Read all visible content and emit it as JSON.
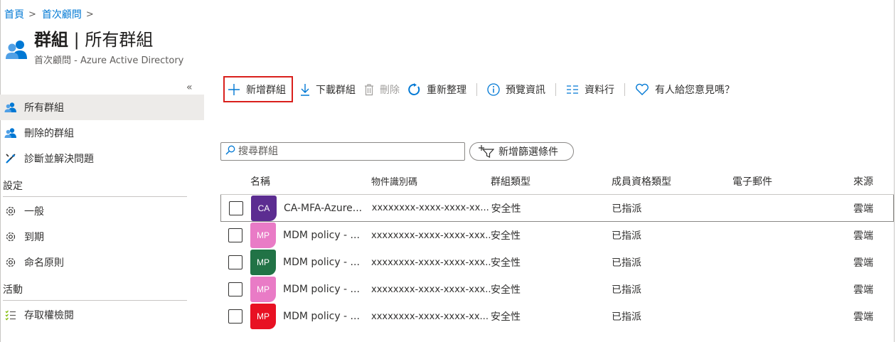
{
  "breadcrumb": {
    "items": [
      "首頁",
      "首次顧問"
    ]
  },
  "header": {
    "title_main": "群組",
    "title_sep": " | ",
    "title_sub": "所有群組",
    "subtitle": "首次顧問 - Azure Active Directory",
    "icon": "groups-icon"
  },
  "sidebar": {
    "collapse_label": "«",
    "items": [
      {
        "label": "所有群組",
        "icon": "groups-icon",
        "active": true
      },
      {
        "label": "刪除的群組",
        "icon": "groups-icon",
        "active": false
      },
      {
        "label": "診斷並解決問題",
        "icon": "wrench-icon",
        "active": false
      }
    ],
    "sections": [
      {
        "title": "設定",
        "items": [
          {
            "label": "一般",
            "icon": "gear-icon"
          },
          {
            "label": "到期",
            "icon": "gear-icon"
          },
          {
            "label": "命名原則",
            "icon": "gear-icon"
          }
        ]
      },
      {
        "title": "活動",
        "items": [
          {
            "label": "存取權檢閱",
            "icon": "checklist-icon"
          }
        ]
      }
    ]
  },
  "toolbar": {
    "new_group": "新增群組",
    "download": "下載群組",
    "delete": "刪除",
    "refresh": "重新整理",
    "preview": "預覽資訊",
    "columns": "資料行",
    "feedback": "有人給您意見嗎？"
  },
  "search": {
    "placeholder": "搜尋群組"
  },
  "filter": {
    "label": "新增篩選條件"
  },
  "table": {
    "columns": [
      "名稱",
      "物件識別碼",
      "群組類型",
      "成員資格類型",
      "電子郵件",
      "來源"
    ],
    "rows": [
      {
        "initials": "CA",
        "color": "#5c2d91",
        "name": "CA-MFA-Azure...",
        "id": "xxxxxxxx-xxxx-xxxx-xx...",
        "type": "安全性",
        "membership": "已指派",
        "email": "",
        "source": "雲端"
      },
      {
        "initials": "MP",
        "color": "#e97bc6",
        "name": "MDM policy - ...",
        "id": "xxxxxxxx-xxxx-xxxx-xxx...",
        "type": "安全性",
        "membership": "已指派",
        "email": "",
        "source": "雲端"
      },
      {
        "initials": "MP",
        "color": "#217346",
        "name": "MDM policy - ...",
        "id": "xxxxxxxx-xxxx-xxxx-xxx...",
        "type": "安全性",
        "membership": "已指派",
        "email": "",
        "source": "雲端"
      },
      {
        "initials": "MP",
        "color": "#e97bc6",
        "name": "MDM policy - ...",
        "id": "xxxxxxxx-xxxx-xxxx-xxx...",
        "type": "安全性",
        "membership": "已指派",
        "email": "",
        "source": "雲端"
      },
      {
        "initials": "MP",
        "color": "#e81123",
        "name": "MDM policy - ...",
        "id": "xxxxxxxx-xxxx-xxxx-xx...",
        "type": "安全性",
        "membership": "已指派",
        "email": "",
        "source": "雲端"
      }
    ]
  },
  "colors": {
    "accent": "#0078d4",
    "highlight_border": "#d9201c"
  }
}
